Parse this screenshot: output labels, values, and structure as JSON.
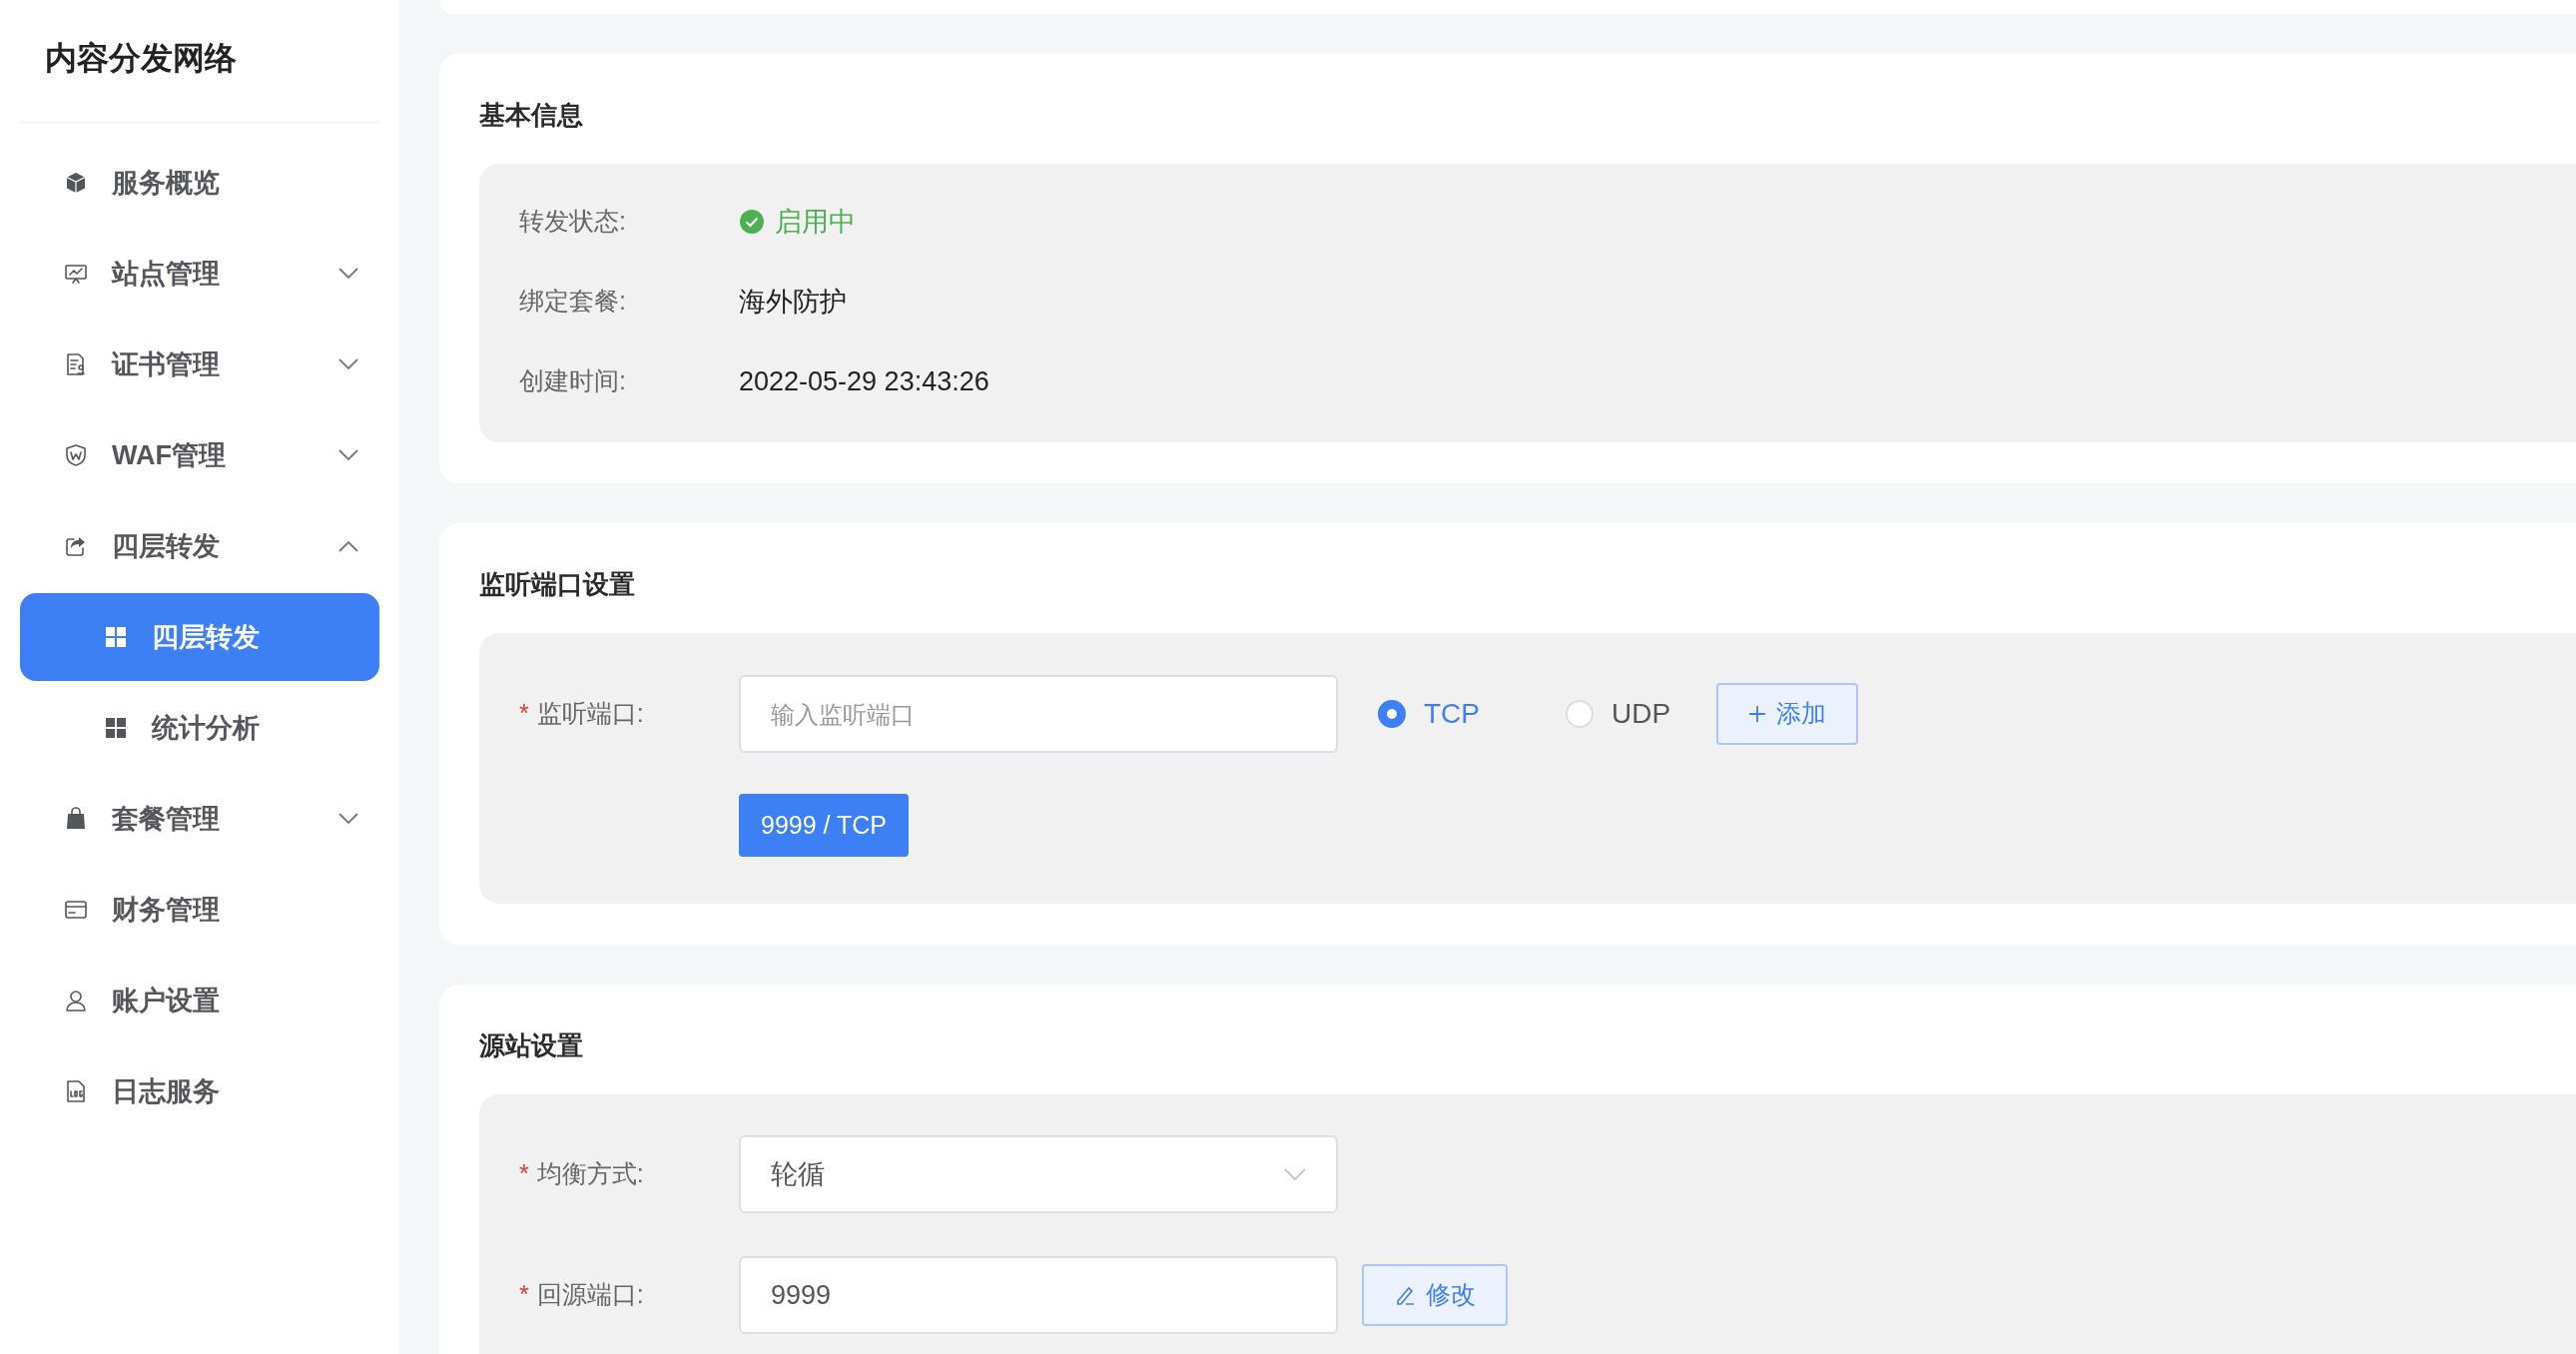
{
  "sidebar": {
    "title": "内容分发网络",
    "items": [
      {
        "label": "服务概览",
        "selected": false
      },
      {
        "label": "站点管理",
        "selected": false,
        "expanded": false
      },
      {
        "label": "证书管理",
        "selected": false,
        "expanded": false
      },
      {
        "label": "WAF管理",
        "selected": false,
        "expanded": false
      },
      {
        "label": "四层转发",
        "selected": false,
        "expanded": true,
        "children": [
          {
            "label": "四层转发",
            "selected": true
          },
          {
            "label": "统计分析",
            "selected": false
          }
        ]
      },
      {
        "label": "套餐管理",
        "selected": false,
        "expanded": false
      },
      {
        "label": "财务管理",
        "selected": false
      },
      {
        "label": "账户设置",
        "selected": false
      },
      {
        "label": "日志服务",
        "selected": false
      }
    ]
  },
  "basic_info": {
    "title": "基本信息",
    "rows": [
      {
        "label": "转发状态:",
        "value": "启用中",
        "kind": "status"
      },
      {
        "label": "绑定套餐:",
        "value": "海外防护",
        "kind": "text"
      },
      {
        "label": "创建时间:",
        "value": "2022-05-29 23:43:26",
        "kind": "text"
      }
    ]
  },
  "listen_ports": {
    "title": "监听端口设置",
    "required_mark": "*",
    "label": "监听端口:",
    "placeholder": "输入监听端口",
    "protocols": [
      {
        "label": "TCP",
        "selected": true
      },
      {
        "label": "UDP",
        "selected": false
      }
    ],
    "add_button": "添加",
    "tags": [
      "9999 / TCP"
    ]
  },
  "origin": {
    "title": "源站设置",
    "fields": [
      {
        "kind": "select",
        "required_mark": "*",
        "label": "均衡方式:",
        "value": "轮循"
      },
      {
        "kind": "input",
        "required_mark": "*",
        "label": "回源端口:",
        "value": "9999",
        "button": "修改"
      }
    ]
  }
}
